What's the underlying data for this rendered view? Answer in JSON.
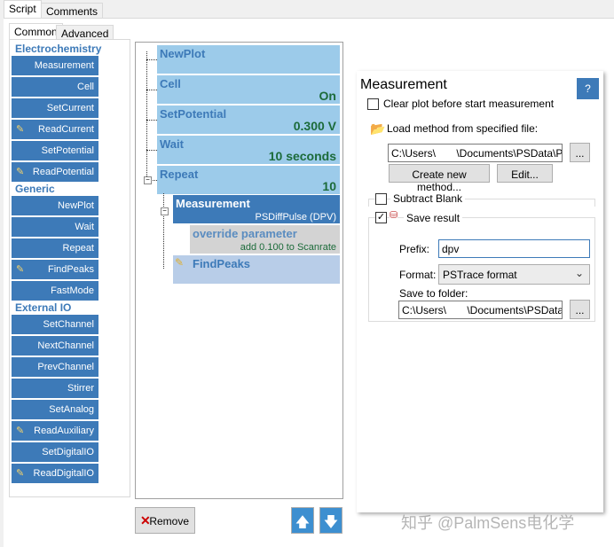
{
  "tabs": [
    "Script",
    "Comments"
  ],
  "subtabs": [
    "Common",
    "Advanced"
  ],
  "toolbox": {
    "groups": [
      {
        "title": "Electrochemistry",
        "items": [
          {
            "label": "Measurement",
            "pencil": false
          },
          {
            "label": "Cell",
            "pencil": false
          },
          {
            "label": "SetCurrent",
            "pencil": false
          },
          {
            "label": "ReadCurrent",
            "pencil": true
          },
          {
            "label": "SetPotential",
            "pencil": false
          },
          {
            "label": "ReadPotential",
            "pencil": true
          }
        ]
      },
      {
        "title": "Generic",
        "items": [
          {
            "label": "NewPlot",
            "pencil": false
          },
          {
            "label": "Wait",
            "pencil": false
          },
          {
            "label": "Repeat",
            "pencil": false
          },
          {
            "label": "FindPeaks",
            "pencil": true
          },
          {
            "label": "FastMode",
            "pencil": false
          }
        ]
      },
      {
        "title": "External IO",
        "items": [
          {
            "label": "SetChannel",
            "pencil": false
          },
          {
            "label": "NextChannel",
            "pencil": false
          },
          {
            "label": "PrevChannel",
            "pencil": false
          },
          {
            "label": "Stirrer",
            "pencil": false
          },
          {
            "label": "SetAnalog",
            "pencil": false
          },
          {
            "label": "ReadAuxiliary",
            "pencil": true
          },
          {
            "label": "SetDigitalIO",
            "pencil": false
          },
          {
            "label": "ReadDigitalIO",
            "pencil": true
          }
        ]
      }
    ]
  },
  "tree": {
    "nodes": [
      {
        "title": "NewPlot",
        "value": ""
      },
      {
        "title": "Cell",
        "value": "On"
      },
      {
        "title": "SetPotential",
        "value": "0.300 V"
      },
      {
        "title": "Wait",
        "value": "10 seconds"
      },
      {
        "title": "Repeat",
        "value": "10"
      }
    ],
    "measurement": {
      "title": "Measurement",
      "value": "PSDiffPulse (DPV)"
    },
    "override": {
      "title": "override parameter",
      "value": "add 0.100 to Scanrate"
    },
    "findpeaks": {
      "title": "FindPeaks"
    }
  },
  "bottom": {
    "remove": "Remove"
  },
  "panel": {
    "title": "Measurement",
    "help": "?",
    "clear_plot": "Clear plot before start measurement",
    "load_method": "Load method from specified file:",
    "method_path": "C:\\Users\\       \\Documents\\PSData\\PS",
    "browse": "...",
    "create": "Create new method...",
    "edit": "Edit...",
    "subtract_blank": "Subtract Blank",
    "save_result": "Save result",
    "prefix_label": "Prefix:",
    "prefix": "dpv",
    "format_label": "Format:",
    "format": "PSTrace format",
    "folder_label": "Save to folder:",
    "folder": "C:\\Users\\       \\Documents\\PSData"
  },
  "watermark": "知乎 @PalmSens电化学"
}
